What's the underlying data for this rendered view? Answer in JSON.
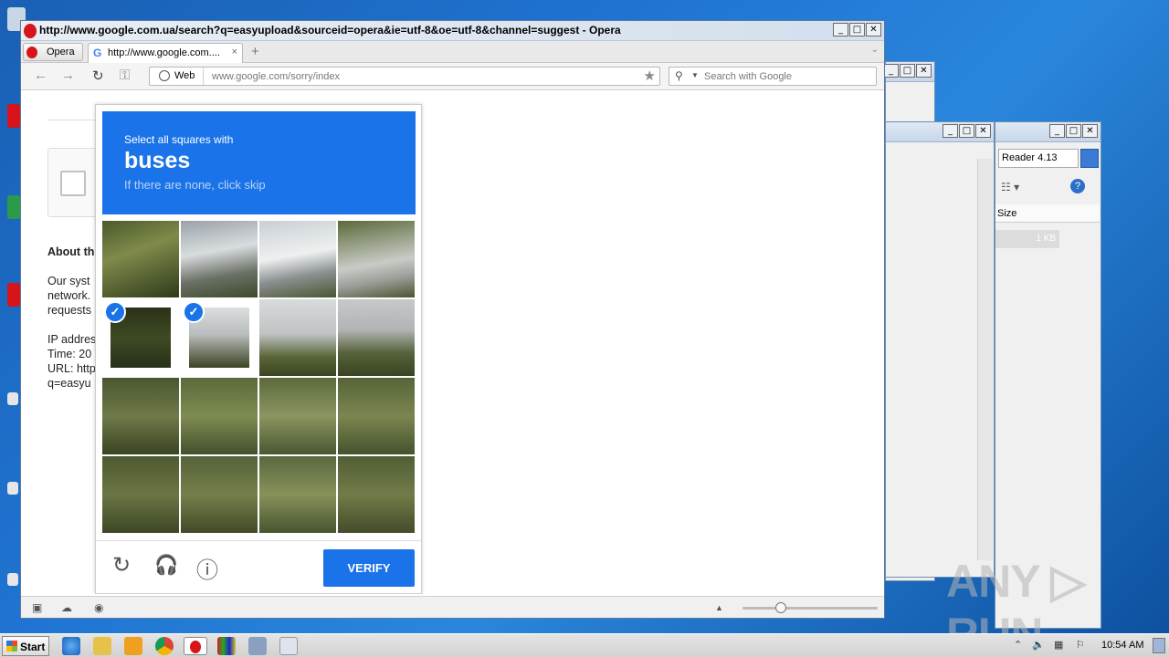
{
  "window": {
    "title": "http://www.google.com.ua/search?q=easyupload&sourceid=opera&ie=utf-8&oe=utf-8&channel=suggest - Opera",
    "btn_min": "_",
    "btn_max": "□",
    "btn_close": "✕"
  },
  "tabs": {
    "menu_label": "Opera",
    "active_tab": "http://www.google.com....",
    "close": "×",
    "new_tab": "+",
    "overflow": "⌄"
  },
  "navbar": {
    "back": "←",
    "forward": "→",
    "reload": "↻",
    "key": "⚿",
    "web_label": "Web",
    "url": "www.google.com/sorry/index",
    "star": "★",
    "search_placeholder": "Search with Google",
    "search_icon": "⚲",
    "search_arrow": "▼"
  },
  "sorry_page": {
    "heading": "About th",
    "line1": "Our syst",
    "line2": "network.",
    "line3": "requests",
    "line4": "IP addres",
    "line5": "Time: 20",
    "line6": "URL: http",
    "line7": "q=easyu"
  },
  "captcha": {
    "instruction": "Select all squares with",
    "target": "buses",
    "hint": "If there are none, click skip",
    "verify_label": "VERIFY",
    "reload_icon": "↻",
    "audio_icon": "🎧",
    "info_icon": "ⓘ",
    "check_mark": "✓",
    "selected_tiles": [
      4,
      5
    ]
  },
  "background_windows": {
    "reader_search": "Reader 4.13",
    "size_header": "Size",
    "size_value": "1 KB"
  },
  "taskbar": {
    "start_label": "Start",
    "clock": "10:54 AM"
  },
  "watermark": "ANY ▷ RUN"
}
